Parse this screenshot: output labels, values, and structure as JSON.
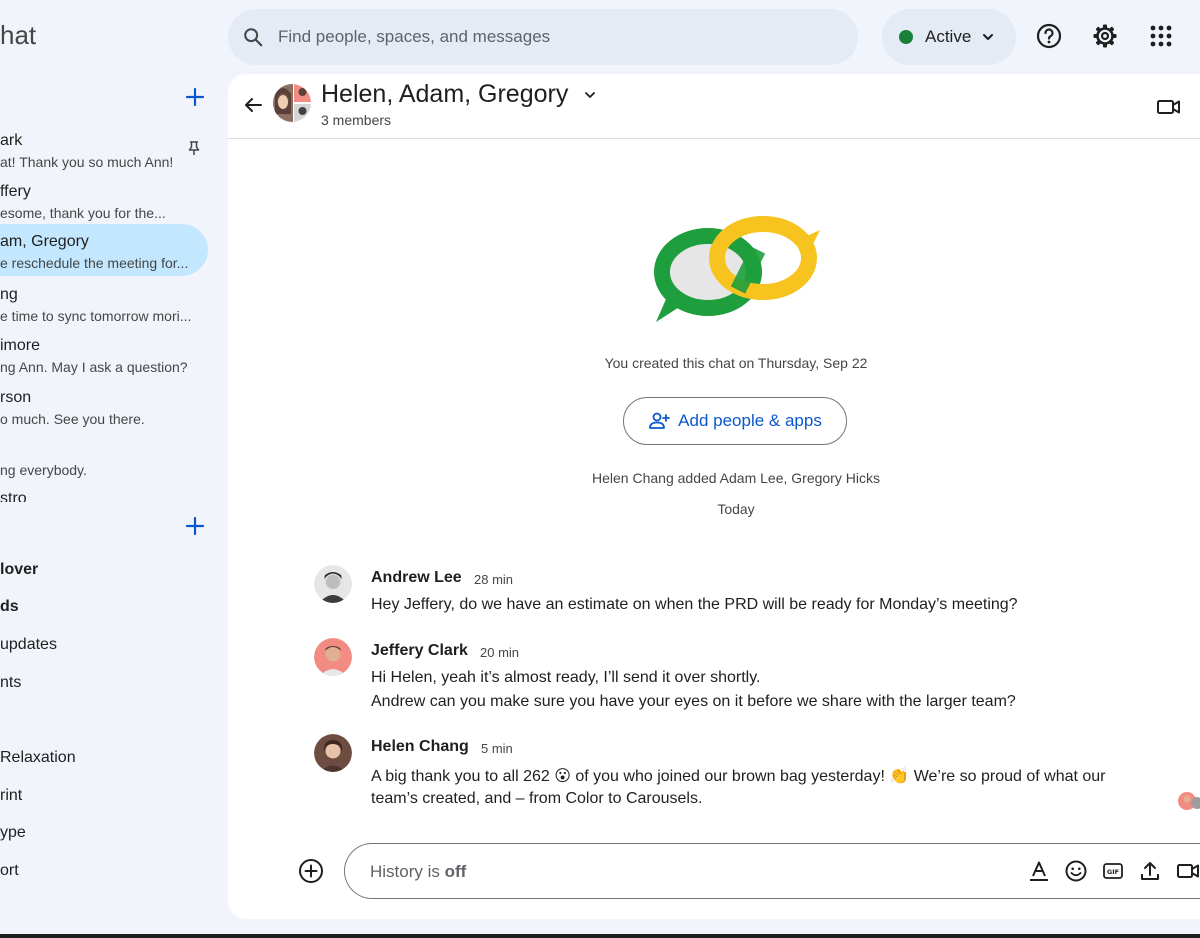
{
  "app": {
    "title": "hat"
  },
  "search": {
    "placeholder": "Find people, spaces, and messages"
  },
  "status": {
    "label": "Active",
    "color": "#188038"
  },
  "icons": {
    "search": "search-icon",
    "help": "help-icon",
    "settings": "gear-icon",
    "apps": "apps-grid-icon"
  },
  "sidebar": {
    "dms": [
      {
        "name": "ark",
        "snippet": "at! Thank you so much Ann!"
      },
      {
        "name": "ffery",
        "snippet": "esome, thank you for the..."
      },
      {
        "name": "am, Gregory",
        "snippet": "e reschedule the meeting for..."
      },
      {
        "name": "ng",
        "snippet": "e time to sync tomorrow mori..."
      },
      {
        "name": "imore",
        "snippet": "ng Ann. May I ask a question?"
      },
      {
        "name": "rson",
        "snippet": "o much. See you there."
      },
      {
        "name": "",
        "snippet": "ng everybody."
      },
      {
        "name": "stro",
        "snippet": ""
      }
    ],
    "spaces": [
      {
        "name": "lover",
        "bold": true
      },
      {
        "name": "ds",
        "bold": true
      },
      {
        "name": " updates",
        "bold": false
      },
      {
        "name": "nts",
        "bold": false
      },
      {
        "name": "Relaxation",
        "bold": false
      },
      {
        "name": "rint",
        "bold": false
      },
      {
        "name": "ype",
        "bold": false
      },
      {
        "name": "ort",
        "bold": false
      }
    ]
  },
  "chat": {
    "title": "Helen, Adam, Gregory",
    "members": "3 members",
    "created": "You created this chat on Thursday, Sep 22",
    "add_button": "Add people & apps",
    "system_message": "Helen Chang added Adam Lee, Gregory Hicks",
    "day_divider": "Today",
    "messages": [
      {
        "sender": "Andrew Lee",
        "time": "28 min",
        "lines": [
          "Hey Jeffery, do we have an estimate on when the PRD will be ready for Monday’s meeting?"
        ]
      },
      {
        "sender": "Jeffery Clark",
        "time": "20 min",
        "lines": [
          "Hi Helen, yeah it’s almost ready, I’ll send it over shortly.",
          "Andrew can you make sure you have your eyes on it before we share with the larger team?"
        ]
      },
      {
        "sender": "Helen Chang",
        "time": "5 min",
        "lines": [
          "A big thank you to all 262 😮 of you who joined our brown bag yesterday! 👏 We’re so proud of what our",
          "team’s created, and – from Color to Carousels."
        ]
      }
    ]
  },
  "composer": {
    "placeholder_prefix": "History is ",
    "placeholder_state": "off"
  },
  "colors": {
    "accent": "#0b57d0",
    "selected": "#c2e7ff",
    "ring_green": "#1e9e3c",
    "ring_yellow": "#f6c31f"
  }
}
